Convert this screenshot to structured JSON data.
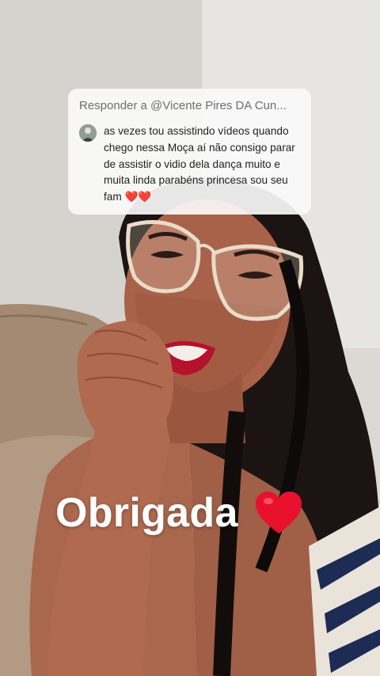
{
  "reply": {
    "header": "Responder a @Vicente Pires DA Cun...",
    "avatar_icon": "user-avatar",
    "comment": "as vezes tou assistindo vídeos quando chego nessa Moça aí não consigo parar de assistir o vidio dela dança muito e muita linda parabéns princesa sou seu fam",
    "comment_emoji": "❤️❤️"
  },
  "caption": {
    "text": "Obrigada",
    "emoji_icon": "heart-icon"
  },
  "colors": {
    "heart": "#e8112d",
    "caption": "#ffffff",
    "card_bg": "#fafafa"
  }
}
